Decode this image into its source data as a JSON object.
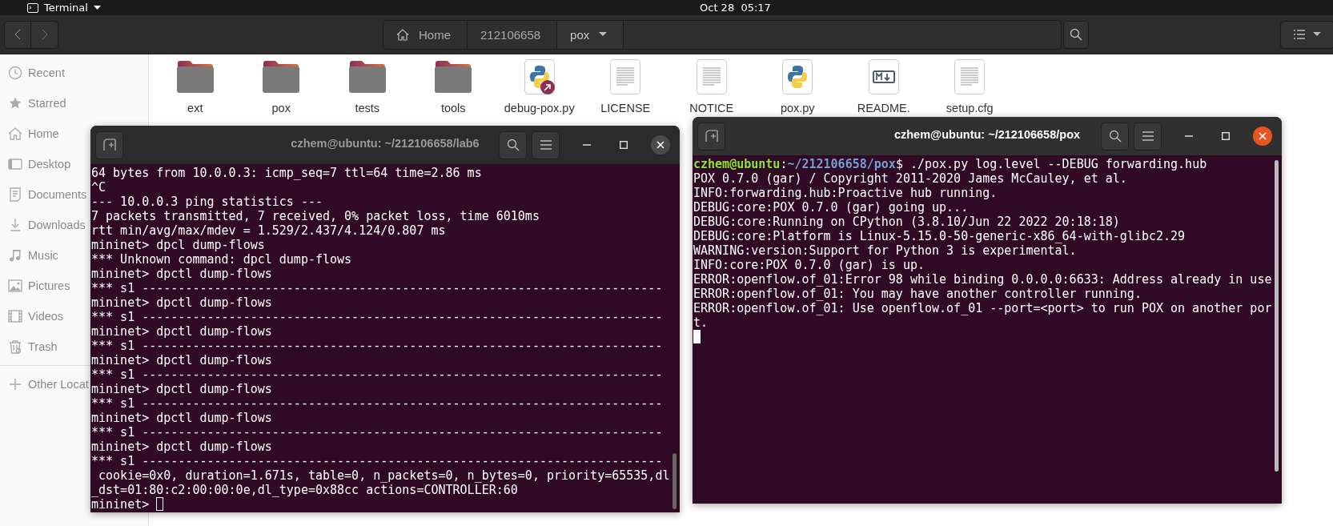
{
  "top_bar": {
    "app_menu": "Terminal",
    "clock": "Oct 28  05:17"
  },
  "file_manager": {
    "path": [
      {
        "label": "Home",
        "kind": "home",
        "selected": false
      },
      {
        "label": "212106658",
        "kind": "folder",
        "selected": false
      },
      {
        "label": "pox",
        "kind": "current",
        "selected": true
      }
    ],
    "sidebar": [
      {
        "label": "Recent",
        "kind": "clock"
      },
      {
        "label": "Starred",
        "kind": "star"
      },
      {
        "label": "Home",
        "kind": "home"
      },
      {
        "label": "Desktop",
        "kind": "desktop"
      },
      {
        "label": "Documents",
        "kind": "document"
      },
      {
        "label": "Downloads",
        "kind": "download"
      },
      {
        "label": "Music",
        "kind": "music"
      },
      {
        "label": "Pictures",
        "kind": "picture"
      },
      {
        "label": "Videos",
        "kind": "film"
      },
      {
        "label": "Trash",
        "kind": "trash"
      },
      {
        "label": "Other Locat",
        "kind": "plus"
      }
    ],
    "files": [
      {
        "label": "ext",
        "kind": "folder"
      },
      {
        "label": "pox",
        "kind": "folder"
      },
      {
        "label": "tests",
        "kind": "folder"
      },
      {
        "label": "tools",
        "kind": "folder"
      },
      {
        "label": "debug-pox.py",
        "kind": "python-link"
      },
      {
        "label": "LICENSE",
        "kind": "text"
      },
      {
        "label": "NOTICE",
        "kind": "text"
      },
      {
        "label": "pox.py",
        "kind": "python"
      },
      {
        "label": "README.",
        "kind": "markdown"
      },
      {
        "label": "setup.cfg",
        "kind": "text"
      }
    ]
  },
  "terminals": [
    {
      "title": "czhem@ubuntu: ~/212106658/lab6",
      "focused": false,
      "cursor_on_new_line": false,
      "lines": [
        [
          {
            "text": "64 bytes from 10.0.0.3: icmp_seq=7 ttl=64 time=2.86 ms"
          }
        ],
        [
          {
            "text": "^C"
          }
        ],
        [
          {
            "text": "--- 10.0.0.3 ping statistics ---"
          }
        ],
        [
          {
            "text": "7 packets transmitted, 7 received, 0% packet loss, time 6010ms"
          }
        ],
        [
          {
            "text": "rtt min/avg/max/mdev = 1.529/2.437/4.124/0.807 ms"
          }
        ],
        [
          {
            "text": "mininet> dpcl dump-flows"
          }
        ],
        [
          {
            "text": "*** Unknown command: dpcl dump-flows"
          }
        ],
        [
          {
            "text": "mininet> dpctl dump-flows"
          }
        ],
        [
          {
            "text": "*** s1 ------------------------------------------------------------------------"
          }
        ],
        [
          {
            "text": "mininet> dpctl dump-flows"
          }
        ],
        [
          {
            "text": "*** s1 ------------------------------------------------------------------------"
          }
        ],
        [
          {
            "text": "mininet> dpctl dump-flows"
          }
        ],
        [
          {
            "text": "*** s1 ------------------------------------------------------------------------"
          }
        ],
        [
          {
            "text": "mininet> dpctl dump-flows"
          }
        ],
        [
          {
            "text": "*** s1 ------------------------------------------------------------------------"
          }
        ],
        [
          {
            "text": "mininet> dpctl dump-flows"
          }
        ],
        [
          {
            "text": "*** s1 ------------------------------------------------------------------------"
          }
        ],
        [
          {
            "text": "mininet> dpctl dump-flows"
          }
        ],
        [
          {
            "text": "*** s1 ------------------------------------------------------------------------"
          }
        ],
        [
          {
            "text": "mininet> dpctl dump-flows"
          }
        ],
        [
          {
            "text": "*** s1 ------------------------------------------------------------------------"
          }
        ],
        [
          {
            "text": " cookie=0x0, duration=1.671s, table=0, n_packets=0, n_bytes=0, priority=65535,dl"
          }
        ],
        [
          {
            "text": "_dst=01:80:c2:00:00:0e,dl_type=0x88cc actions=CONTROLLER:60"
          }
        ],
        [
          {
            "text": "mininet> "
          }
        ]
      ]
    },
    {
      "title": "czhem@ubuntu: ~/212106658/pox",
      "focused": true,
      "cursor_on_new_line": true,
      "lines": [
        [
          {
            "text": "czhem@ubuntu",
            "kind": "user"
          },
          {
            "text": ":"
          },
          {
            "text": "~/212106658/pox",
            "kind": "path"
          },
          {
            "text": "$ ./pox.py log.level --DEBUG forwarding.hub"
          }
        ],
        [
          {
            "text": "POX 0.7.0 (gar) / Copyright 2011-2020 James McCauley, et al."
          }
        ],
        [
          {
            "text": "INFO:forwarding.hub:Proactive hub running."
          }
        ],
        [
          {
            "text": "DEBUG:core:POX 0.7.0 (gar) going up..."
          }
        ],
        [
          {
            "text": "DEBUG:core:Running on CPython (3.8.10/Jun 22 2022 20:18:18)"
          }
        ],
        [
          {
            "text": "DEBUG:core:Platform is Linux-5.15.0-50-generic-x86_64-with-glibc2.29"
          }
        ],
        [
          {
            "text": "WARNING:version:Support for Python 3 is experimental."
          }
        ],
        [
          {
            "text": "INFO:core:POX 0.7.0 (gar) is up."
          }
        ],
        [
          {
            "text": "ERROR:openflow.of_01:Error 98 while binding 0.0.0.0:6633: Address already in use"
          }
        ],
        [
          {
            "text": "ERROR:openflow.of_01: You may have another controller running."
          }
        ],
        [
          {
            "text": "ERROR:openflow.of_01: Use openflow.of_01 --port=<port> to run POX on another por"
          }
        ],
        [
          {
            "text": "t."
          }
        ]
      ]
    }
  ]
}
